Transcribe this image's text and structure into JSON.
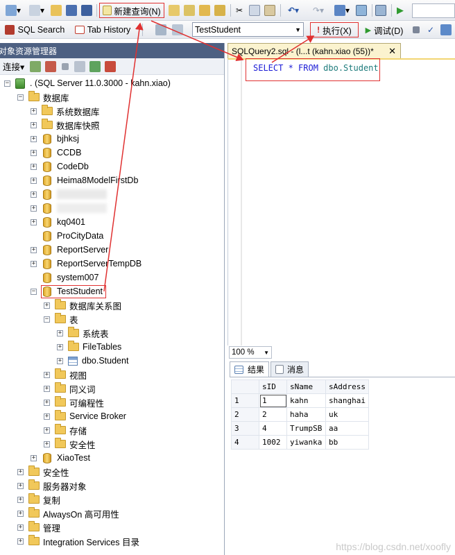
{
  "toolbar1": {
    "new_query_label": "新建查询(N)"
  },
  "toolbar2": {
    "sql_search_label": "SQL Search",
    "tab_history_label": "Tab History",
    "database_select": "TestStudent",
    "execute_label": "执行(X)",
    "debug_label": "调试(D)"
  },
  "object_explorer": {
    "title": "对象资源管理器",
    "connect_label": "连接",
    "server": ". (SQL Server 11.0.3000 - kahn.xiao)",
    "items": [
      {
        "label": "数据库"
      },
      {
        "label": "系统数据库"
      },
      {
        "label": "数据库快照"
      },
      {
        "label": "bjhksj"
      },
      {
        "label": "CCDB"
      },
      {
        "label": "CodeDb"
      },
      {
        "label": "Heima8ModelFirstDb"
      },
      {
        "label": ""
      },
      {
        "label": ""
      },
      {
        "label": "kq0401"
      },
      {
        "label": "ProCityData"
      },
      {
        "label": "ReportServer"
      },
      {
        "label": "ReportServerTempDB"
      },
      {
        "label": "system007"
      },
      {
        "label": "TestStudent"
      },
      {
        "label": "数据库关系图"
      },
      {
        "label": "表"
      },
      {
        "label": "系统表"
      },
      {
        "label": "FileTables"
      },
      {
        "label": "dbo.Student"
      },
      {
        "label": "视图"
      },
      {
        "label": "同义词"
      },
      {
        "label": "可编程性"
      },
      {
        "label": "Service Broker"
      },
      {
        "label": "存储"
      },
      {
        "label": "安全性"
      },
      {
        "label": "XiaoTest"
      },
      {
        "label": "安全性"
      },
      {
        "label": "服务器对象"
      },
      {
        "label": "复制"
      },
      {
        "label": "AlwaysOn 高可用性"
      },
      {
        "label": "管理"
      },
      {
        "label": "Integration Services 目录"
      }
    ]
  },
  "editor": {
    "tab_title": "SQLQuery2.sql - (l...t (kahn.xiao (55))*",
    "query_keywords": "SELECT * FROM ",
    "query_object": "dbo.Student",
    "zoom": "100 %"
  },
  "results": {
    "tabs": [
      "结果",
      "消息"
    ],
    "columns": [
      "sID",
      "sName",
      "sAddress"
    ],
    "rows": [
      {
        "n": "1",
        "cells": [
          "1",
          "kahn",
          "shanghai"
        ]
      },
      {
        "n": "2",
        "cells": [
          "2",
          "haha",
          "uk"
        ]
      },
      {
        "n": "3",
        "cells": [
          "4",
          "TrumpSB",
          "aa"
        ]
      },
      {
        "n": "4",
        "cells": [
          "1002",
          "yiwanka",
          "bb"
        ]
      }
    ]
  },
  "watermark": "https://blog.csdn.net/xoofly",
  "colors": {
    "annotation": "#e03030",
    "panel_title": "#4d6082",
    "tab_active": "#fbf3cf"
  }
}
